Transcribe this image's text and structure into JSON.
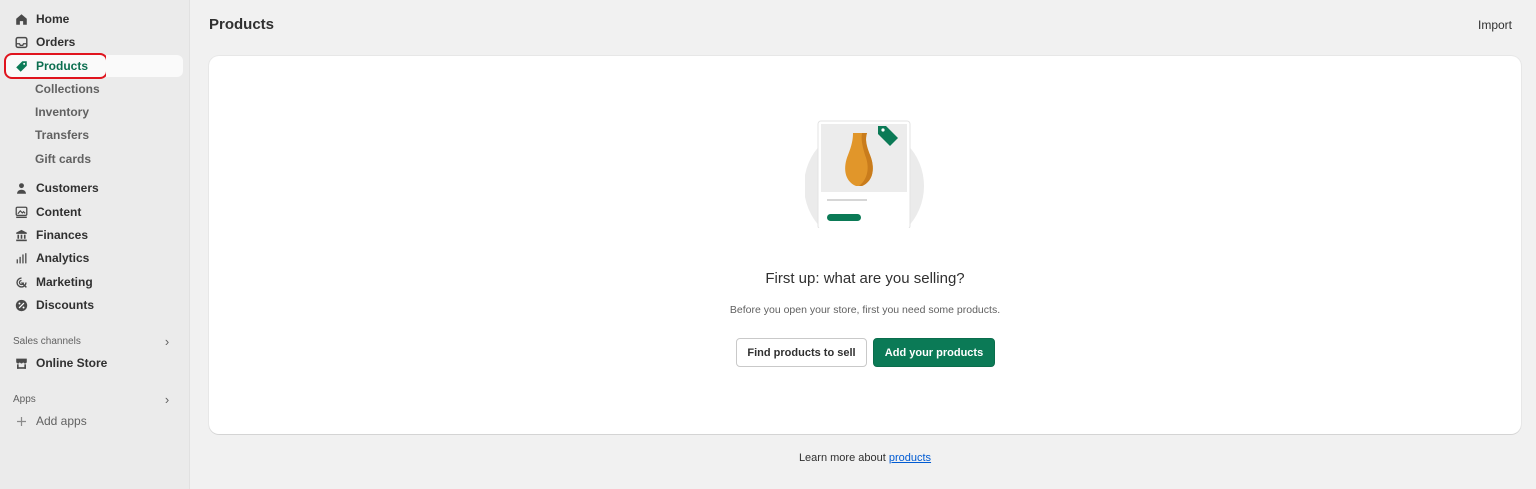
{
  "sidebar": {
    "items": [
      {
        "label": "Home",
        "icon": "home-icon"
      },
      {
        "label": "Orders",
        "icon": "inbox-icon"
      },
      {
        "label": "Products",
        "icon": "tag-icon"
      },
      {
        "label": "Customers",
        "icon": "person-icon"
      },
      {
        "label": "Content",
        "icon": "image-icon"
      },
      {
        "label": "Finances",
        "icon": "bank-icon"
      },
      {
        "label": "Analytics",
        "icon": "bar-chart-icon"
      },
      {
        "label": "Marketing",
        "icon": "target-icon"
      },
      {
        "label": "Discounts",
        "icon": "discount-icon"
      }
    ],
    "product_subitems": [
      "Collections",
      "Inventory",
      "Transfers",
      "Gift cards"
    ],
    "sales_channels": {
      "label": "Sales channels",
      "chevron": "›",
      "items": [
        {
          "label": "Online Store",
          "icon": "store-icon"
        }
      ]
    },
    "apps": {
      "label": "Apps",
      "chevron": "›",
      "add_label": "Add apps",
      "add_icon": "plus-icon"
    }
  },
  "header": {
    "title": "Products",
    "import_label": "Import"
  },
  "empty_state": {
    "heading": "First up: what are you selling?",
    "subtext": "Before you open your store, first you need some products.",
    "secondary_button": "Find products to sell",
    "primary_button": "Add your products"
  },
  "footer": {
    "text": "Learn more about",
    "link": "products"
  },
  "colors": {
    "accent": "#0b7a56",
    "highlight_box": "#e0141e",
    "link": "#005bd3"
  }
}
